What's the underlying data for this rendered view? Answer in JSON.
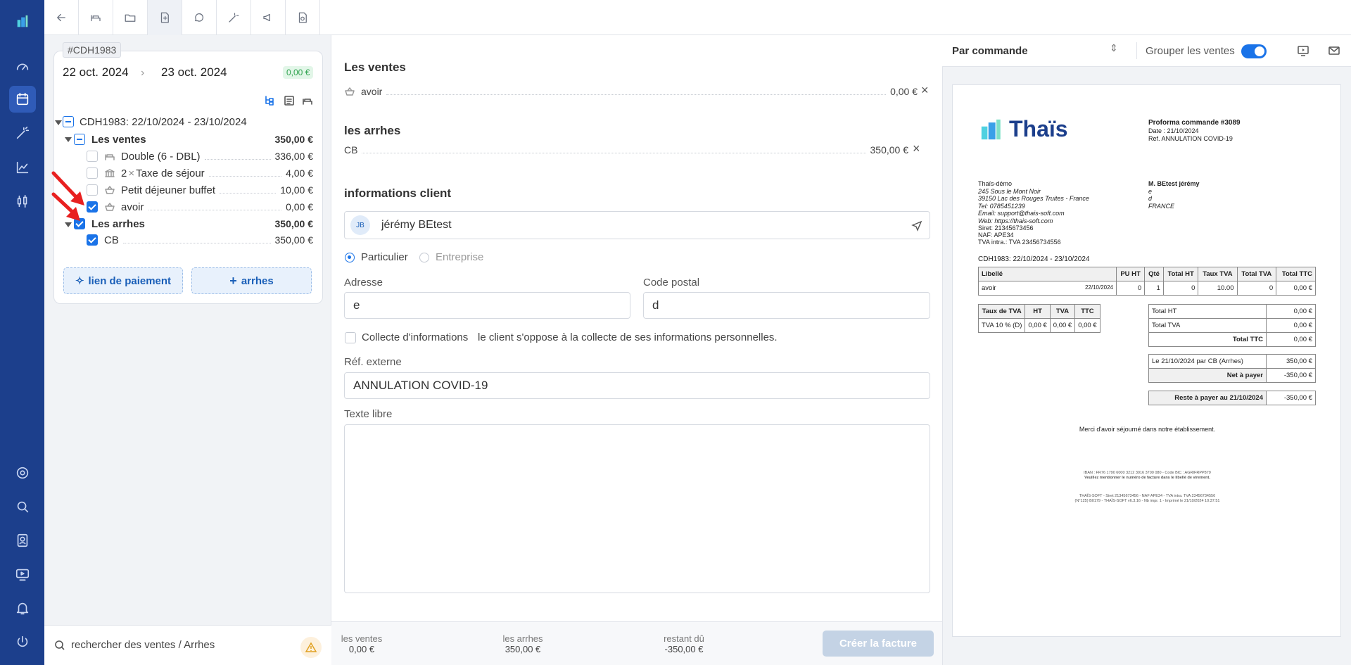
{
  "sales_panel": {
    "booking_tag": "#CDH1983",
    "date_start": "22 oct. 2024",
    "date_end": "23 oct. 2024",
    "balance_badge": "0,00 €",
    "tree": {
      "root_label": "CDH1983: 22/10/2024 - 23/10/2024",
      "sales_group": {
        "label": "Les ventes",
        "amount": "350,00 €"
      },
      "sales_items": [
        {
          "label": "Double (6 - DBL)",
          "amount": "336,00 €",
          "icon": "bed-icon",
          "checked": false
        },
        {
          "label": "Taxe de séjour",
          "qty": "2",
          "amount": "4,00 €",
          "icon": "bank-icon",
          "checked": false
        },
        {
          "label": "Petit déjeuner buffet",
          "amount": "10,00 €",
          "icon": "basket-icon",
          "checked": false
        },
        {
          "label": "avoir",
          "amount": "0,00 €",
          "icon": "basket-icon",
          "checked": true
        }
      ],
      "deposits_group": {
        "label": "Les arrhes",
        "amount": "350,00 €"
      },
      "deposit_items": [
        {
          "label": "CB",
          "amount": "350,00 €",
          "checked": true
        }
      ]
    },
    "payment_link_button": "lien de paiement",
    "add_deposit_button": "arrhes",
    "search_placeholder": "rechercher des ventes / Arrhes"
  },
  "invoice_form": {
    "sales_title": "Les ventes",
    "sales_line": {
      "label": "avoir",
      "amount": "0,00 €"
    },
    "deposits_title": "les arrhes",
    "deposits_line": {
      "label": "CB",
      "amount": "350,00 €"
    },
    "client_title": "informations client",
    "client_initials": "JB",
    "client_name": "jérémy BEtest",
    "type_private": "Particulier",
    "type_company": "Entreprise",
    "address_label": "Adresse",
    "address_value": "e",
    "postal_label": "Code postal",
    "postal_value": "d",
    "collect_label": "Collecte d'informations",
    "collect_desc": "le client s'oppose à la collecte de ses informations personnelles.",
    "ext_ref_label": "Réf. externe",
    "ext_ref_value": "ANNULATION COVID-19",
    "free_text_label": "Texte libre"
  },
  "footer": {
    "sales_label": "les ventes",
    "sales_value": "0,00 €",
    "deposits_label": "les arrhes",
    "deposits_value": "350,00 €",
    "due_label": "restant dû",
    "due_value": "-350,00 €",
    "create_button": "Créer la facture"
  },
  "preview": {
    "mode_select": "Par commande",
    "group_label": "Grouper les ventes",
    "group_enabled": true,
    "brand": "Thaïs",
    "doc_title": "Proforma commande #3089",
    "doc_date": "Date : 21/10/2024",
    "doc_ref": "Ref. ANNULATION COVID-19",
    "hotel_name": "Thaïs-démo",
    "hotel_lines": [
      "245 Sous le Mont Noir",
      "39150 Lac des Rouges Truites - France",
      "Tel: 0785451239",
      "Email: support@thais-soft.com",
      "Web: https://thais-soft.com",
      "Siret: 21345673456",
      "NAF: APE34",
      "TVA intra.: TVA 23456734556"
    ],
    "client_lines": [
      "M. BEtest jérémy",
      "e",
      "d",
      "FRANCE"
    ],
    "stay_line": "CDH1983: 22/10/2024 - 23/10/2024",
    "table_headers": [
      "Libellé",
      "PU HT",
      "Qté",
      "Total HT",
      "Taux TVA",
      "Total TVA",
      "Total TTC"
    ],
    "table_row": {
      "label": "avoir",
      "date": "22/10/2024",
      "pu": "0",
      "qty": "1",
      "ht": "0",
      "rate": "10.00",
      "tva": "0",
      "ttc": "0,00 €"
    },
    "vat_headers": [
      "Taux de TVA",
      "HT",
      "TVA",
      "TTC"
    ],
    "vat_row": [
      "TVA 10 % (D)",
      "0,00 €",
      "0,00 €",
      "0,00 €"
    ],
    "totals": [
      [
        "Total HT",
        "0,00 €"
      ],
      [
        "Total TVA",
        "0,00 €"
      ],
      [
        "Total TTC",
        "0,00 €"
      ]
    ],
    "payment_line": [
      "Le 21/10/2024 par CB (Arrhes)",
      "350,00 €"
    ],
    "net_line": [
      "Net à payer",
      "-350,00 €"
    ],
    "rest_line": [
      "Reste à payer au 21/10/2024",
      "-350,00 €"
    ],
    "thanks": "Merci d'avoir séjourné dans notre établissement.",
    "iban_line": "IBAN : FR76 1790 6000 3212 3016 3700 080 - Code BIC : AGRIFRPP879",
    "iban_note": "Veuillez mentionner le numéro de facture dans le libellé de virement.",
    "legal_line1": "THAÏS-SOFT - Siret 21345673456 - NAF APE34 - TVA intra. TVA 23456734556",
    "legal_line2": "(N°125) B0179 - THAÏS-SOFT v6.3.16 - Nb impr. 1 - Imprimé le 21/10/2024 10:37:51"
  }
}
